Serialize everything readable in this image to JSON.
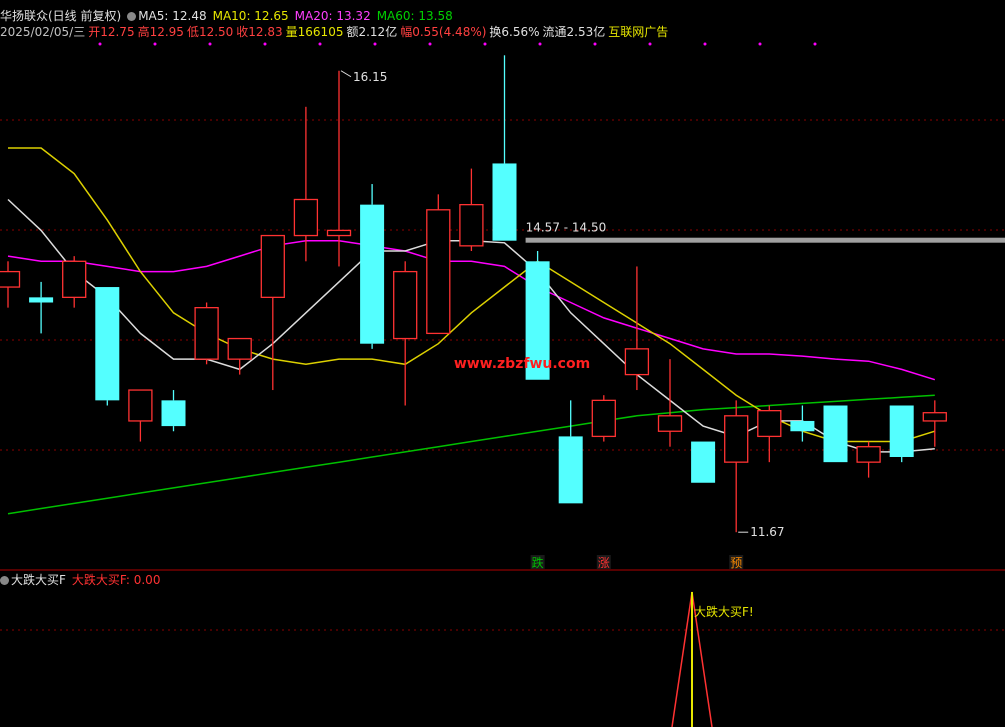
{
  "header": {
    "stock_name": "华扬联众(日线 前复权)",
    "ma5": "MA5: 12.48",
    "ma10": "MA10: 12.65",
    "ma20": "MA20: 13.32",
    "ma60": "MA60: 13.58",
    "date": "2025/02/05/三",
    "open": "开12.75",
    "high": "高12.95",
    "low": "低12.50",
    "close": "收12.83",
    "volume": "量166105",
    "amount": "额2.12亿",
    "change": "幅0.55(4.48%)",
    "turnover": "换6.56%",
    "float": "流通2.53亿",
    "sector": "互联网广告"
  },
  "colors": {
    "up": "#ff3232",
    "down": "#54ffff",
    "ma5": "#dcdcdc",
    "ma10": "#dcd000",
    "ma20": "#ff00ff",
    "ma60": "#00c000",
    "grid": "#8b0000",
    "resistance": "#a0a0a0"
  },
  "chart_data": {
    "type": "candlestick",
    "candles": [
      {
        "o": 14.05,
        "h": 14.3,
        "l": 13.85,
        "c": 14.2
      },
      {
        "o": 13.95,
        "h": 14.1,
        "l": 13.6,
        "c": 13.9
      },
      {
        "o": 13.95,
        "h": 14.35,
        "l": 13.85,
        "c": 14.3
      },
      {
        "o": 14.05,
        "h": 14.05,
        "l": 12.9,
        "c": 12.95
      },
      {
        "o": 12.75,
        "h": 13.0,
        "l": 12.55,
        "c": 13.05
      },
      {
        "o": 12.95,
        "h": 13.05,
        "l": 12.65,
        "c": 12.7
      },
      {
        "o": 13.35,
        "h": 13.9,
        "l": 13.3,
        "c": 13.85
      },
      {
        "o": 13.35,
        "h": 13.55,
        "l": 13.2,
        "c": 13.55
      },
      {
        "o": 13.95,
        "h": 14.55,
        "l": 13.05,
        "c": 14.55
      },
      {
        "o": 14.55,
        "h": 15.8,
        "l": 14.3,
        "c": 14.9
      },
      {
        "o": 14.55,
        "h": 16.15,
        "l": 14.25,
        "c": 14.6
      },
      {
        "o": 14.85,
        "h": 15.05,
        "l": 13.45,
        "c": 13.5
      },
      {
        "o": 13.55,
        "h": 14.3,
        "l": 12.9,
        "c": 14.2
      },
      {
        "o": 13.6,
        "h": 14.95,
        "l": 13.6,
        "c": 14.8
      },
      {
        "o": 14.45,
        "h": 15.2,
        "l": 14.4,
        "c": 14.85
      },
      {
        "o": 15.25,
        "h": 16.3,
        "l": 14.5,
        "c": 14.5
      },
      {
        "o": 14.3,
        "h": 14.4,
        "l": 13.15,
        "c": 13.15
      },
      {
        "o": 12.6,
        "h": 12.95,
        "l": 11.95,
        "c": 11.95
      },
      {
        "o": 12.6,
        "h": 13.0,
        "l": 12.55,
        "c": 12.95
      },
      {
        "o": 13.2,
        "h": 14.25,
        "l": 13.05,
        "c": 13.45
      },
      {
        "o": 12.65,
        "h": 13.35,
        "l": 12.5,
        "c": 12.8
      },
      {
        "o": 12.55,
        "h": 12.55,
        "l": 12.15,
        "c": 12.15
      },
      {
        "o": 12.35,
        "h": 12.95,
        "l": 11.67,
        "c": 12.8
      },
      {
        "o": 12.6,
        "h": 12.9,
        "l": 12.35,
        "c": 12.85
      },
      {
        "o": 12.75,
        "h": 12.9,
        "l": 12.55,
        "c": 12.65
      },
      {
        "o": 12.9,
        "h": 12.9,
        "l": 12.35,
        "c": 12.35
      },
      {
        "o": 12.35,
        "h": 12.55,
        "l": 12.2,
        "c": 12.5
      },
      {
        "o": 12.9,
        "h": 12.9,
        "l": 12.35,
        "c": 12.4
      },
      {
        "o": 12.75,
        "h": 12.95,
        "l": 12.5,
        "c": 12.83
      }
    ],
    "ma5": [
      14.9,
      14.6,
      14.2,
      13.95,
      13.6,
      13.35,
      13.35,
      13.25,
      13.5,
      13.8,
      14.1,
      14.4,
      14.4,
      14.5,
      14.5,
      14.48,
      14.2,
      13.8,
      13.5,
      13.2,
      12.95,
      12.7,
      12.6,
      12.75,
      12.75,
      12.55,
      12.45,
      12.45,
      12.48
    ],
    "ma10": [
      15.4,
      15.4,
      15.15,
      14.7,
      14.2,
      13.8,
      13.6,
      13.45,
      13.35,
      13.3,
      13.35,
      13.35,
      13.3,
      13.5,
      13.8,
      14.05,
      14.3,
      14.1,
      13.9,
      13.7,
      13.5,
      13.25,
      13.0,
      12.8,
      12.65,
      12.55,
      12.55,
      12.55,
      12.65
    ],
    "ma20": [
      14.35,
      14.3,
      14.3,
      14.25,
      14.2,
      14.2,
      14.25,
      14.35,
      14.45,
      14.5,
      14.5,
      14.45,
      14.4,
      14.3,
      14.3,
      14.25,
      14.05,
      13.9,
      13.75,
      13.65,
      13.55,
      13.45,
      13.4,
      13.4,
      13.38,
      13.35,
      13.33,
      13.25,
      13.15
    ],
    "ma60": [
      11.85,
      11.9,
      11.95,
      12.0,
      12.05,
      12.1,
      12.15,
      12.2,
      12.25,
      12.3,
      12.35,
      12.4,
      12.45,
      12.5,
      12.55,
      12.6,
      12.65,
      12.7,
      12.75,
      12.8,
      12.83,
      12.86,
      12.88,
      12.9,
      12.92,
      12.94,
      12.96,
      12.98,
      13.0
    ],
    "price_range": [
      11.4,
      16.4
    ],
    "resistance_zone": {
      "label": "14.57 - 14.50",
      "value": 14.5,
      "start_index": 16
    },
    "annotations": [
      {
        "index": 10,
        "price": 16.15,
        "label": "16.15"
      },
      {
        "index": 22,
        "price": 11.67,
        "label": "11.67"
      }
    ],
    "signals": [
      {
        "index": 16,
        "label": "跌",
        "color": "#00c000"
      },
      {
        "index": 18,
        "label": "涨",
        "color": "#ff3232"
      },
      {
        "index": 22,
        "label": "预",
        "color": "#ff8c00"
      }
    ],
    "lower_indicator": {
      "name": "大跌大买F",
      "value_label": "大跌大买F: 0.00",
      "signal_label": "大跌大买F!",
      "signal_index": 20
    }
  },
  "watermark": "www.zbzfwu.com"
}
